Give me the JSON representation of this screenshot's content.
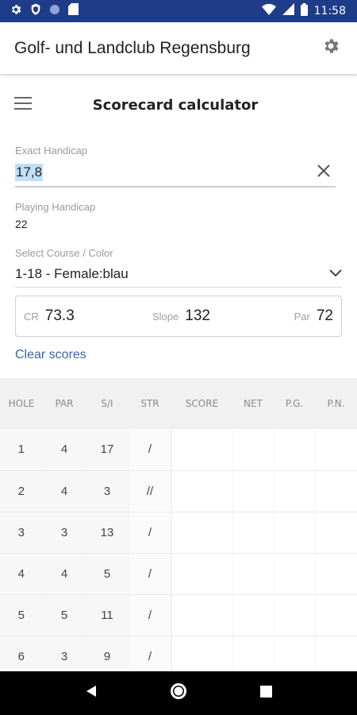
{
  "status_bar": {
    "time": "11:58",
    "left_icons": [
      "settings-icon",
      "shield-icon",
      "circle-icon",
      "sd-card-icon"
    ],
    "right_icons": [
      "wifi-icon",
      "signal-icon",
      "battery-icon"
    ]
  },
  "app_bar": {
    "title": "Golf- und Landclub Regensburg",
    "settings_icon": "gear-icon"
  },
  "page": {
    "title": "Scorecard calculator",
    "menu_icon": "hamburger-menu-icon"
  },
  "form": {
    "exact_handicap_label": "Exact Handicap",
    "exact_handicap_value": "17,8",
    "playing_handicap_label": "Playing Handicap",
    "playing_handicap_value": "22",
    "course_label": "Select Course / Color",
    "course_value": "1-18 - Female:blau"
  },
  "course_rating": {
    "cr_label": "CR",
    "cr_value": "73.3",
    "slope_label": "Slope",
    "slope_value": "132",
    "par_label": "Par",
    "par_value": "72"
  },
  "actions": {
    "clear_scores": "Clear scores"
  },
  "table": {
    "columns": [
      "HOLE",
      "PAR",
      "S/I",
      "STR",
      "SCORE",
      "NET",
      "P.G.",
      "P.N."
    ],
    "rows": [
      {
        "hole": "1",
        "par": "4",
        "si": "17",
        "str": "/"
      },
      {
        "hole": "2",
        "par": "4",
        "si": "3",
        "str": "//"
      },
      {
        "hole": "3",
        "par": "3",
        "si": "13",
        "str": "/"
      },
      {
        "hole": "4",
        "par": "4",
        "si": "5",
        "str": "/"
      },
      {
        "hole": "5",
        "par": "5",
        "si": "11",
        "str": "/"
      },
      {
        "hole": "6",
        "par": "3",
        "si": "9",
        "str": "/"
      }
    ]
  },
  "colors": {
    "status_bar": "#1f3c88",
    "accent_link": "#3a64a8",
    "selection": "#bfe0f7",
    "input_underline": "#c9cbe9"
  }
}
